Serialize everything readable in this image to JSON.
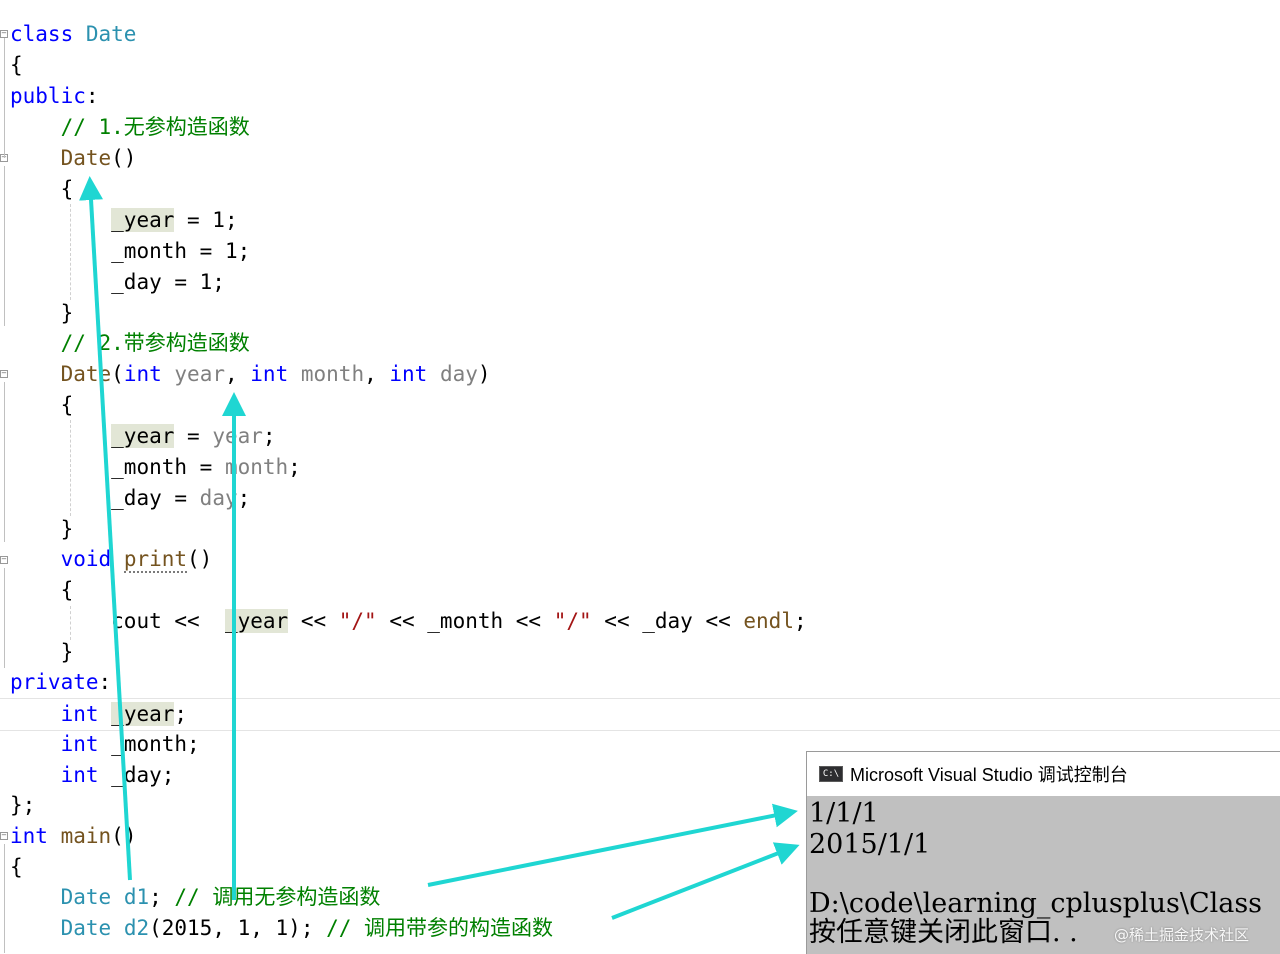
{
  "code": {
    "l1": {
      "kw": "class",
      "name": "Date"
    },
    "l2": {
      "brace": "{"
    },
    "l3": {
      "kw": "public",
      "colon": ":"
    },
    "l4": {
      "comment": "// 1.无参构造函数"
    },
    "l5": {
      "fn": "Date",
      "rest": "()"
    },
    "l6": {
      "brace": "{"
    },
    "l7": {
      "member": "_year",
      "rest": " = 1;"
    },
    "l8": {
      "member": "_month",
      "rest": " = 1;"
    },
    "l9": {
      "member": "_day",
      "rest": " = 1;"
    },
    "l10": {
      "brace": "}"
    },
    "l11": {
      "comment": "// 2.带参构造函数"
    },
    "l12": {
      "fn": "Date",
      "open": "(",
      "t1": "int",
      "p1": "year",
      "sep1": ", ",
      "t2": "int",
      "p2": "month",
      "sep2": ", ",
      "t3": "int",
      "p3": "day",
      "close": ")"
    },
    "l13": {
      "brace": "{"
    },
    "l14": {
      "member": "_year",
      "mid": " = ",
      "param": "year",
      "end": ";"
    },
    "l15": {
      "member": "_month",
      "mid": " = ",
      "param": "month",
      "end": ";"
    },
    "l16": {
      "member": "_day",
      "mid": " = ",
      "param": "day",
      "end": ";"
    },
    "l17": {
      "brace": "}"
    },
    "l18": {
      "kw": "void",
      "fn": "print",
      "rest": "()"
    },
    "l19": {
      "brace": "{"
    },
    "l20": {
      "cout": "cout",
      "op1": " << ",
      "m1": "_year",
      "op2": " << ",
      "s1": "\"/\"",
      "op3": " << ",
      "m2": "_month",
      "op4": " << ",
      "s2": "\"/\"",
      "op5": " << ",
      "m3": "_day",
      "op6": " << ",
      "endl": "endl",
      "end": ";"
    },
    "l21": {
      "brace": "}"
    },
    "l22": {
      "kw": "private",
      "colon": ":"
    },
    "l23": {
      "type": "int",
      "member": "_year",
      "end": ";"
    },
    "l24": {
      "type": "int",
      "member": "_month",
      "end": ";"
    },
    "l25": {
      "type": "int",
      "member": "_day",
      "end": ";"
    },
    "l26": {
      "text": "};"
    },
    "l27": {
      "type": "int",
      "fn": "main",
      "rest": "()"
    },
    "l28": {
      "brace": "{"
    },
    "l29": {
      "cls": "Date",
      "var": "d1",
      "end": "; ",
      "comment": "// 调用无参构造函数"
    },
    "l30": {
      "cls": "Date",
      "var": "d2",
      "args": "(2015, 1, 1); ",
      "comment": "// 调用带参的构造函数"
    }
  },
  "console": {
    "title": "Microsoft Visual Studio 调试控制台",
    "icon_label": "C:\\",
    "lines": [
      "1/1/1",
      "2015/1/1",
      "",
      "D:\\code\\learning_cplusplus\\Class",
      "按任意键关闭此窗口. ."
    ]
  },
  "watermark": "@稀土掘金技术社区",
  "colors": {
    "keyword": "#0000ff",
    "type": "#2b91af",
    "function": "#74531f",
    "comment": "#008000",
    "string": "#a31515",
    "parameter": "#808080",
    "highlight": "#e2e6d6",
    "arrow": "#1fd6d2",
    "console_bg": "#c0c0c0"
  }
}
